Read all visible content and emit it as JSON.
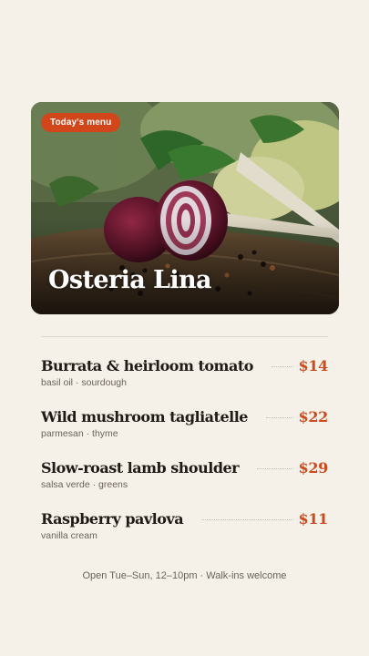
{
  "hero": {
    "badge": "Today's menu",
    "title": "Osteria Lina",
    "image": "vegetables-onion-peppercorns-photo"
  },
  "menu": {
    "items": [
      {
        "name": "Burrata & heirloom tomato",
        "description": "basil oil · sourdough",
        "price": "$14"
      },
      {
        "name": "Wild mushroom tagliatelle",
        "description": "parmesan · thyme",
        "price": "$22"
      },
      {
        "name": "Slow-roast lamb shoulder",
        "description": "salsa verde · greens",
        "price": "$29"
      },
      {
        "name": "Raspberry pavlova",
        "description": "vanilla cream",
        "price": "$11"
      }
    ]
  },
  "footer": {
    "text": "Open Tue–Sun, 12–10pm · Walk-ins welcome"
  },
  "colors": {
    "background": "#f5f0e8",
    "accent": "#d2461c",
    "price": "#cc4a1c",
    "heading": "#1f1b16",
    "muted": "#6a635a"
  }
}
